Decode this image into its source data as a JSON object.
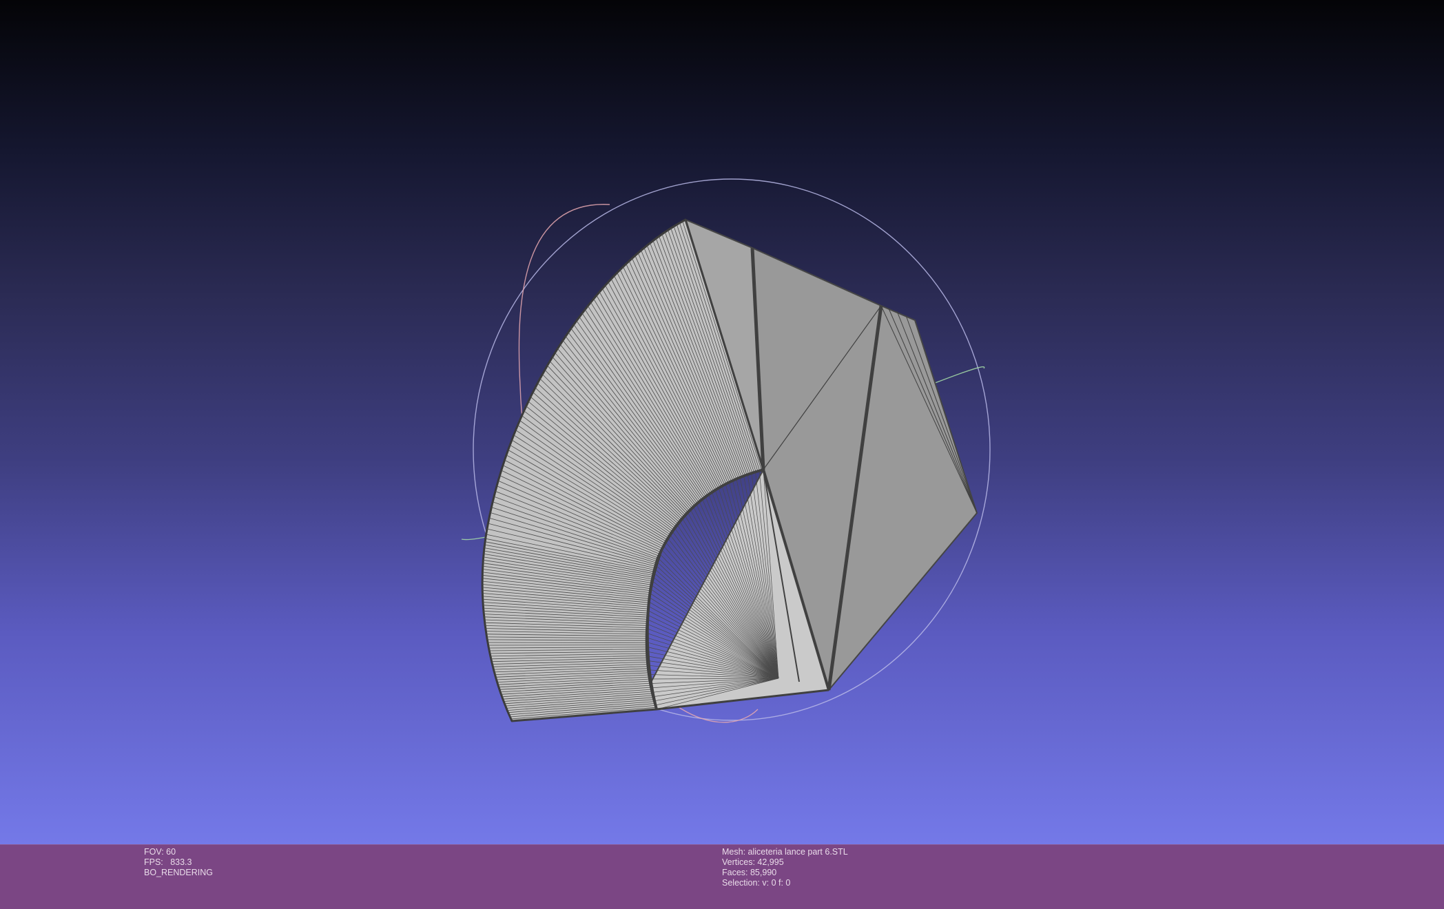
{
  "viewport": {
    "background_top": "#040407",
    "background_bottom": "#7479e8",
    "mesh_fill": "#bdbdbd",
    "mesh_edge": "#3c3c3c",
    "trackball_colors": {
      "x_ring": "#e6a8b0",
      "y_ring": "#a8e0a8",
      "z_ring": "#b8b8e8"
    }
  },
  "info_bar": {
    "background": "#7b4684",
    "left": {
      "fov": "FOV: 60",
      "fps": "FPS:   833.3",
      "render_mode": "BO_RENDERING"
    },
    "right": {
      "mesh": "Mesh: aliceteria lance part 6.STL",
      "vertices": "Vertices: 42,995",
      "faces": "Faces: 85,990",
      "selection": "Selection: v: 0 f: 0"
    }
  }
}
